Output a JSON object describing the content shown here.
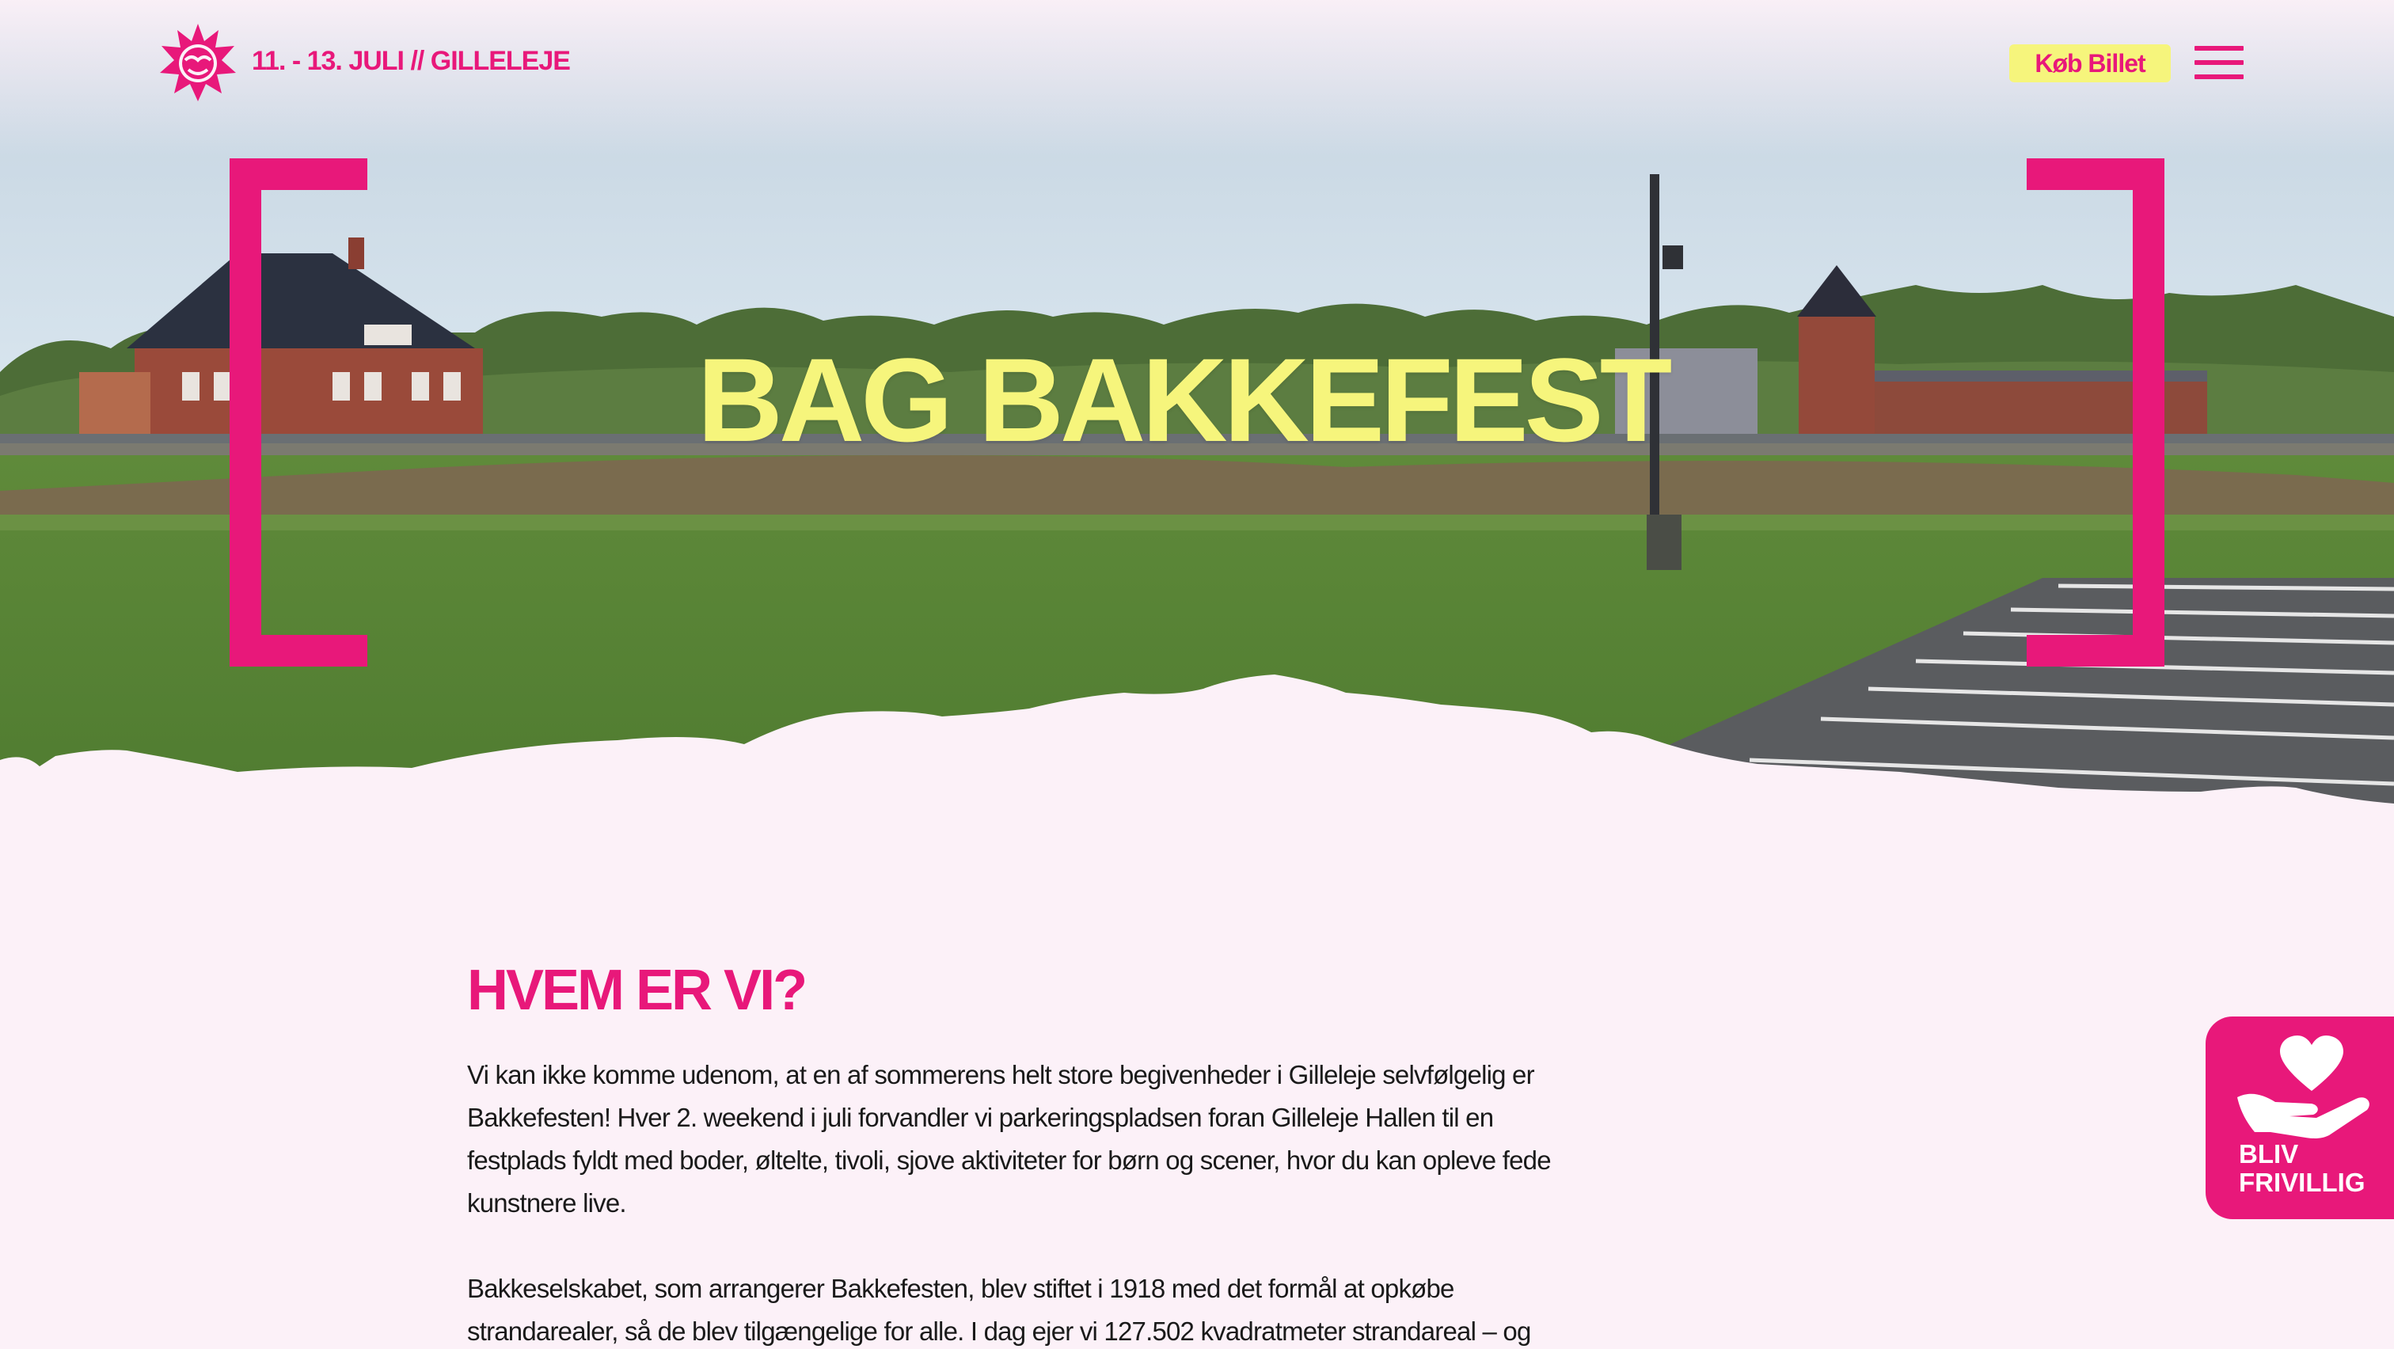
{
  "header": {
    "date_location": "11. - 13. JULI // GILLELEJE",
    "buy_ticket_label": "Køb Billet"
  },
  "hero": {
    "title": "BAG BAKKEFEST"
  },
  "about": {
    "title": "HVEM ER VI?",
    "paragraphs": [
      "Vi kan ikke komme udenom, at en af sommerens helt store begivenheder i Gilleleje selvfølgelig er Bakkefesten! Hver 2. weekend i juli forvandler vi parkeringspladsen foran Gilleleje Hallen til en festplads fyldt med boder, øltelte, tivoli, sjove aktiviteter for børn og scener, hvor du kan opleve fede kunstnere live.",
      "Bakkeselskabet, som arrangerer Bakkefesten, blev stiftet i 1918 med det formål at opkøbe strandarealer, så de blev tilgængelige for alle. I dag ejer vi 127.502 kvadratmeter strandareal – og"
    ]
  },
  "volunteer": {
    "label_line1": "BLIV",
    "label_line2": "FRIVILLIG"
  },
  "colors": {
    "brand_pink": "#e8187a",
    "brand_yellow": "#f6f57c",
    "page_background": "#fcf1f8"
  },
  "icons": {
    "logo": "sun-logo-icon",
    "menu": "hamburger-menu-icon",
    "volunteer": "heart-hand-icon"
  }
}
